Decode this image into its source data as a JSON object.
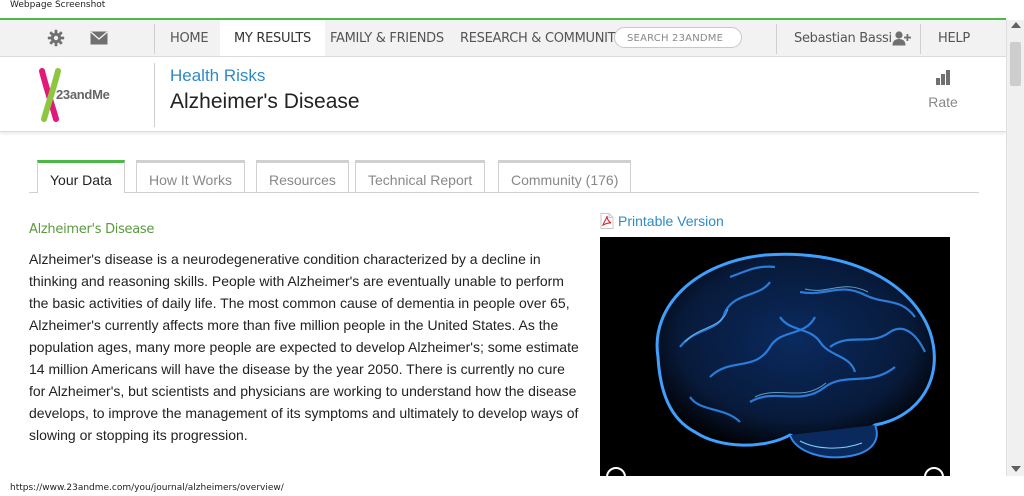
{
  "window": {
    "capture_label": "Webpage Screenshot"
  },
  "nav": {
    "home": "HOME",
    "my_results": "MY RESULTS",
    "family_friends": "FAMILY & FRIENDS",
    "research_community": "RESEARCH & COMMUNITY",
    "search_placeholder": "SEARCH 23ANDME",
    "user_name": "Sebastian Bassi",
    "help": "HELP",
    "icons": {
      "settings": "gear-icon",
      "messages": "envelope-icon",
      "user": "user-icon"
    }
  },
  "header": {
    "logo_text": "23andMe",
    "breadcrumb": "Health Risks",
    "title": "Alzheimer's Disease",
    "rate_label": "Rate"
  },
  "tabs": [
    {
      "label": "Your Data"
    },
    {
      "label": "How It Works"
    },
    {
      "label": "Resources"
    },
    {
      "label": "Technical Report"
    },
    {
      "label": "Community (176)"
    }
  ],
  "content": {
    "heading": "Alzheimer's Disease",
    "body": "Alzheimer's disease is a neurodegenerative condition characterized by a decline in thinking and reasoning skills. People with Alzheimer's are eventually unable to perform the basic activities of daily life. The most common cause of dementia in people over 65, Alzheimer's currently affects more than five million people in the United States. As the population ages, many more people are expected to develop Alzheimer's; some estimate 14 million Americans will have the disease by the year 2050. There is currently no cure for Alzheimer's, but scientists and physicians are working to understand how the disease develops, to improve the management of its symptoms and ultimately to develop ways of slowing or stopping its progression.",
    "printable_label": "Printable Version"
  },
  "status": {
    "url": "https://www.23andme.com/you/journal/alzheimers/overview/"
  },
  "colors": {
    "accent_green": "#4cb848",
    "link_blue": "#2e8ac7",
    "heading_green": "#5a9a3c",
    "logo_green": "#8dc63f",
    "logo_pink": "#e2197a"
  }
}
